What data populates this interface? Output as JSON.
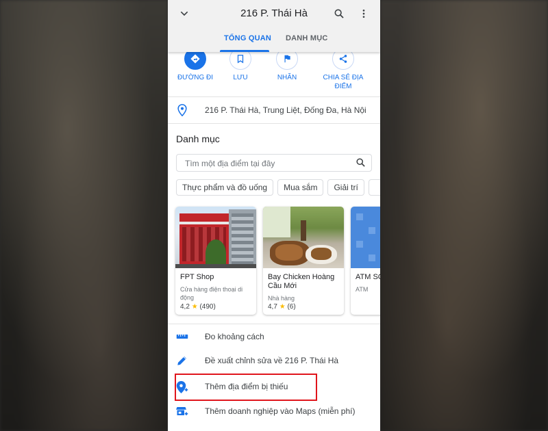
{
  "header": {
    "title": "216 P. Thái Hà",
    "tabs": [
      {
        "label": "TỔNG QUAN",
        "active": true
      },
      {
        "label": "DANH MỤC",
        "active": false
      }
    ]
  },
  "actions": [
    {
      "label": "ĐƯỜNG ĐI",
      "icon": "directions-icon"
    },
    {
      "label": "LƯU",
      "icon": "bookmark-icon"
    },
    {
      "label": "NHÃN",
      "icon": "flag-icon"
    },
    {
      "label_line1": "CHIA SẺ ĐỊA",
      "label_line2": "ĐIỂM",
      "icon": "share-icon"
    }
  ],
  "address": {
    "text": "216 P. Thái Hà, Trung Liệt, Đống Đa, Hà Nội",
    "icon": "location-pin-icon"
  },
  "directory": {
    "title": "Danh mục",
    "search_placeholder": "Tìm một địa điểm tại đây",
    "chips": [
      "Thực phẩm và đồ uống",
      "Mua sắm",
      "Giải trí"
    ],
    "cards": [
      {
        "name": "FPT Shop",
        "subtitle": "Cửa hàng điện thoại di động",
        "rating": "4,2",
        "reviews": "(490)"
      },
      {
        "name": "Bay Chicken Hoàng Cầu Mới",
        "subtitle": "Nhà hàng",
        "rating": "4,7",
        "reviews": "(6)"
      },
      {
        "name": "ATM SC",
        "subtitle": "ATM"
      }
    ]
  },
  "menu": [
    {
      "label": "Đo khoảng cách",
      "icon": "ruler-icon"
    },
    {
      "label": "Đề xuất chỉnh sửa về 216 P. Thái Hà",
      "icon": "pencil-icon"
    },
    {
      "label": "Thêm địa điểm bị thiếu",
      "icon": "add-location-icon"
    },
    {
      "label": "Thêm doanh nghiệp vào Maps (miễn phí)",
      "icon": "add-business-icon"
    }
  ],
  "colors": {
    "accent": "#1a73e8",
    "highlight": "#e0141b",
    "star": "#fbbc04"
  }
}
